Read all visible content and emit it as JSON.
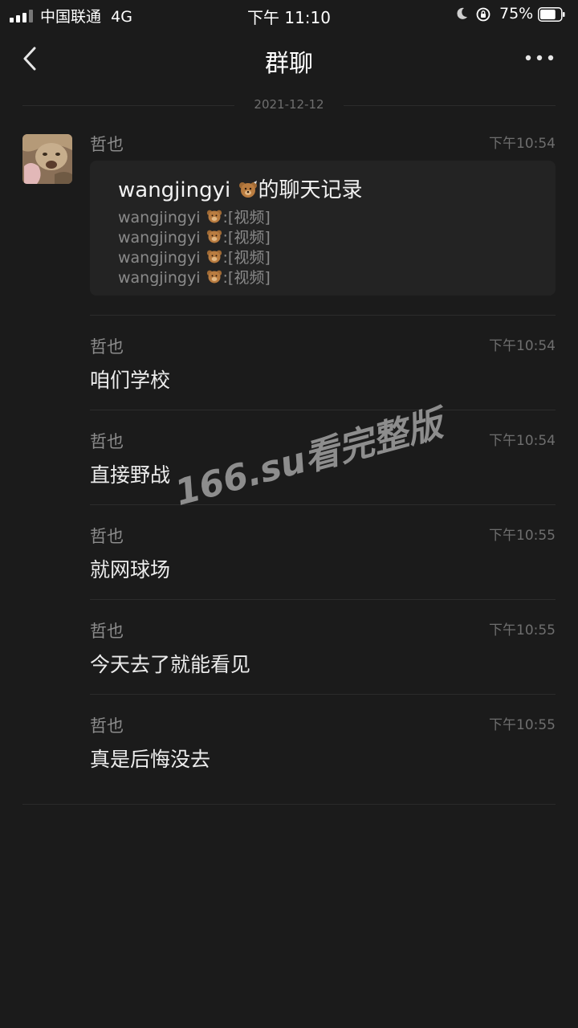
{
  "status_bar": {
    "carrier": "中国联通",
    "network": "4G",
    "time": "下午 11:10",
    "battery_percent": "75%",
    "battery_level": 0.75
  },
  "nav": {
    "back_icon": "chevron-left-icon",
    "title": "群聊",
    "more_icon": "more-dots-icon"
  },
  "date_separator": "2021-12-12",
  "chat_record": {
    "sender": "哲也",
    "time": "下午10:54",
    "title_name": "wangjingyi",
    "title_suffix": "的聊天记录",
    "lines": [
      {
        "name": "wangjingyi",
        "text": ":[视频]"
      },
      {
        "name": "wangjingyi",
        "text": ":[视频]"
      },
      {
        "name": "wangjingyi",
        "text": ":[视频]"
      },
      {
        "name": "wangjingyi",
        "text": ":[视频]"
      }
    ]
  },
  "messages": [
    {
      "sender": "哲也",
      "time": "下午10:54",
      "text": "咱们学校"
    },
    {
      "sender": "哲也",
      "time": "下午10:54",
      "text": "直接野战"
    },
    {
      "sender": "哲也",
      "time": "下午10:55",
      "text": "就网球场"
    },
    {
      "sender": "哲也",
      "time": "下午10:55",
      "text": "今天去了就能看见"
    },
    {
      "sender": "哲也",
      "time": "下午10:55",
      "text": "真是后悔没去"
    }
  ],
  "watermark": "166.su看完整版",
  "colors": {
    "background": "#1b1b1b",
    "card": "#232323",
    "divider": "#2c2c2c"
  }
}
